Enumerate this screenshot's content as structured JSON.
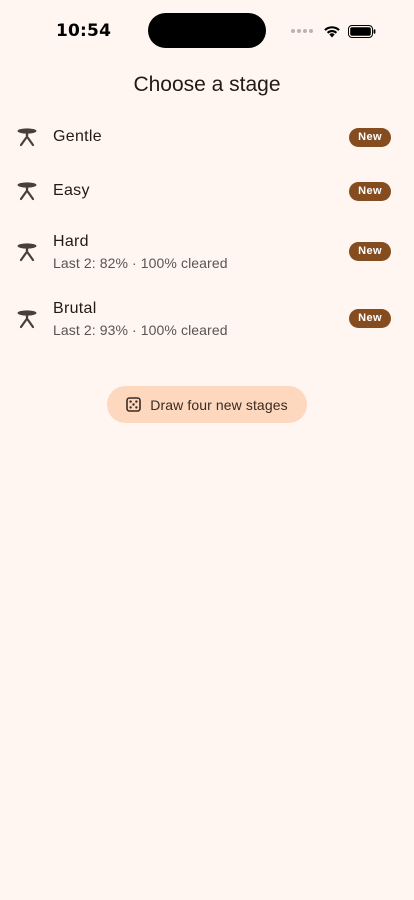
{
  "status_bar": {
    "time": "10:54",
    "icons": [
      "signal-dots-icon",
      "wifi-icon",
      "battery-icon"
    ]
  },
  "header": {
    "title": "Choose a stage"
  },
  "stages": [
    {
      "name": "Gentle",
      "subtitle": "",
      "badge": "New",
      "icon": "stool-icon"
    },
    {
      "name": "Easy",
      "subtitle": "",
      "badge": "New",
      "icon": "stool-icon"
    },
    {
      "name": "Hard",
      "subtitle": "Last 2: 82% · 100% cleared",
      "badge": "New",
      "icon": "stool-icon"
    },
    {
      "name": "Brutal",
      "subtitle": "Last 2: 93% · 100% cleared",
      "badge": "New",
      "icon": "stool-icon"
    }
  ],
  "actions": {
    "draw_label": "Draw four new stages",
    "draw_icon": "dice-icon"
  },
  "colors": {
    "background": "#fff6f2",
    "badge": "#844c1f",
    "button": "#fdd7be",
    "text": "#241a15"
  }
}
